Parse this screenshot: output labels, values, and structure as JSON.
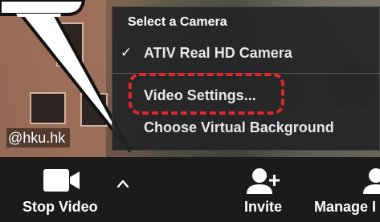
{
  "window": {
    "email_fragment": "@hku.hk"
  },
  "camera_menu": {
    "heading": "Select a Camera",
    "items": [
      {
        "label": "ATIV Real HD Camera",
        "checked": true
      },
      {
        "label": "Video Settings...",
        "highlighted": true
      },
      {
        "label": "Choose Virtual Background"
      }
    ],
    "check_symbol": "✓"
  },
  "toolbar": {
    "stop_video_label": "Stop Video",
    "invite_label": "Invite",
    "manage_label": "Manage I"
  },
  "icons": {
    "video": "video-camera-icon",
    "chevron": "chevron-up-icon",
    "invite": "add-person-icon",
    "manage": "participants-icon"
  },
  "colors": {
    "highlight": "#e1262c",
    "toolbar_bg": "#1b1b1b",
    "menu_bg": "#232426"
  }
}
